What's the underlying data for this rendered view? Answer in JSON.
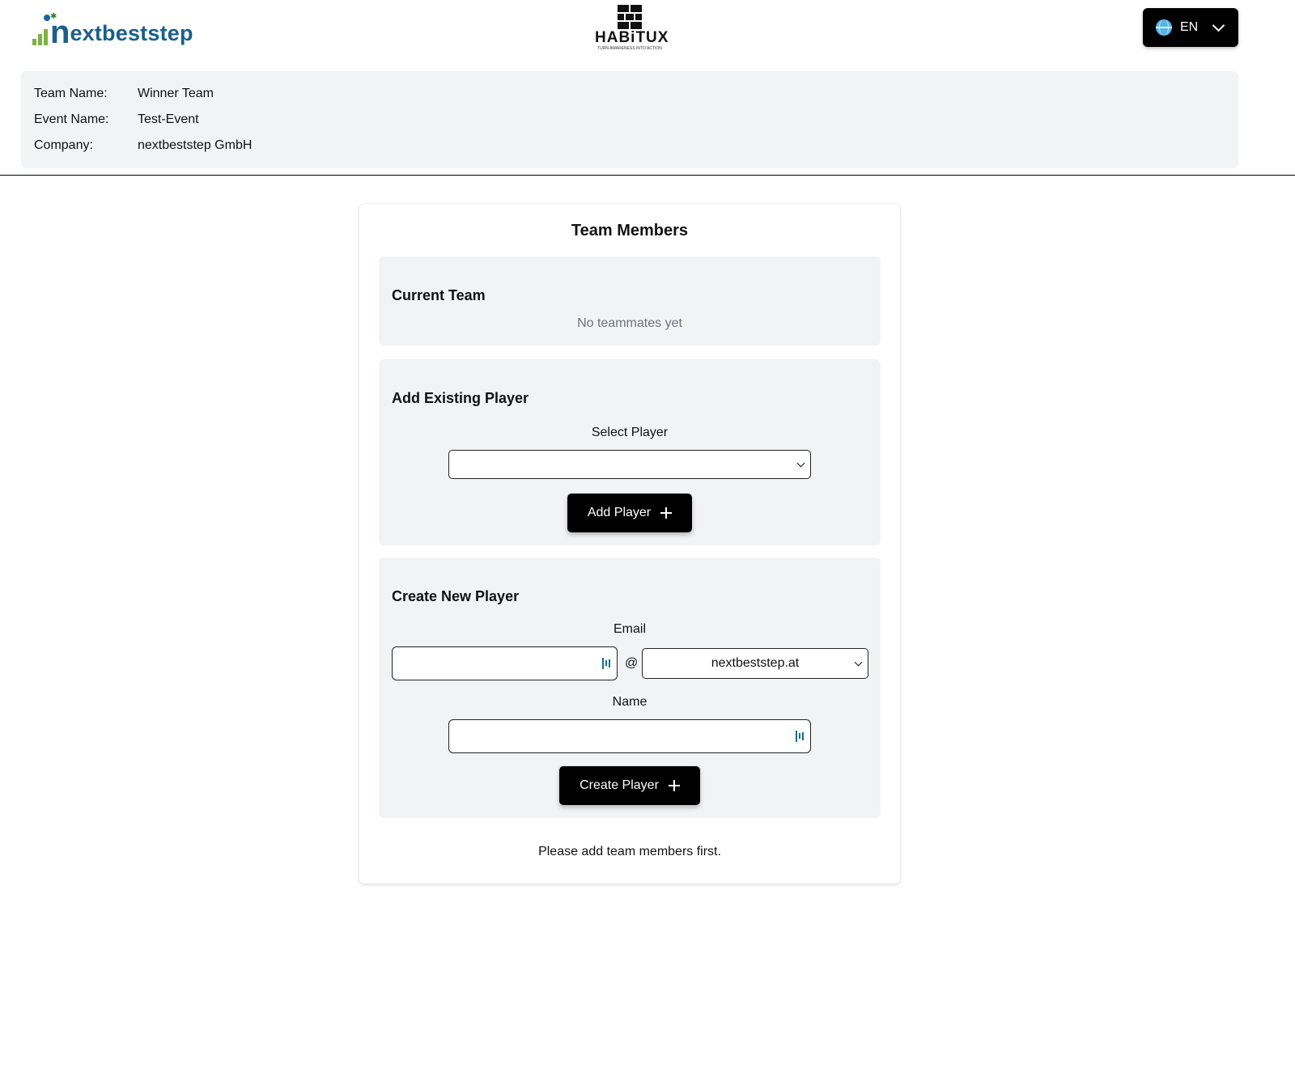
{
  "header": {
    "brand_left_n": "n",
    "brand_left_text": "extbeststep",
    "brand_center_word": "HABiTUX",
    "brand_center_tagline": "TURN AWARENESS INTO ACTION",
    "language": {
      "label": "EN",
      "icon": "globe-icon"
    }
  },
  "info": {
    "team_name_label": "Team Name:",
    "team_name_value": "Winner Team",
    "event_name_label": "Event Name:",
    "event_name_value": "Test-Event",
    "company_label": "Company:",
    "company_value": "nextbeststep GmbH"
  },
  "card": {
    "title": "Team Members",
    "current_team": {
      "title": "Current Team",
      "empty_text": "No teammates yet"
    },
    "add_existing": {
      "title": "Add Existing Player",
      "select_label": "Select Player",
      "selected_value": "",
      "button_label": "Add Player"
    },
    "create_new": {
      "title": "Create New Player",
      "email_label": "Email",
      "email_local_value": "",
      "at_symbol": "@",
      "domain_selected": "nextbeststep.at",
      "name_label": "Name",
      "name_value": "",
      "button_label": "Create Player"
    },
    "footer_message": "Please add team members first."
  },
  "colors": {
    "brand_blue": "#1a5f8a",
    "brand_green": "#7cb342",
    "panel_bg": "#f2f3f5",
    "button_bg": "#000000",
    "muted_text": "#6b7280"
  }
}
